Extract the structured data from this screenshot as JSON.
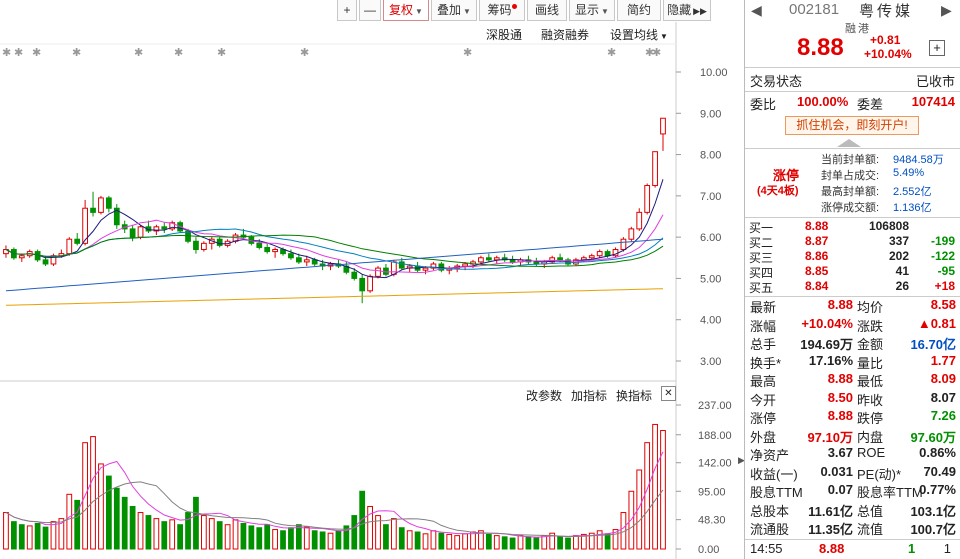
{
  "toolbar": {
    "plus": "+",
    "minus": "—",
    "restore": "复权",
    "overlay": "叠加",
    "chips": "筹码",
    "line_draw": "画线",
    "display": "显示",
    "simple": "简约",
    "hide": "隐藏"
  },
  "chart_links": {
    "shenzhen_connect": "深股通",
    "margin": "融资融券",
    "set_ma": "设置均线"
  },
  "indicator_links": {
    "change_params": "改参数",
    "add_indicator": "加指标",
    "swap_indicator": "换指标",
    "close": "✕"
  },
  "price_axis": [
    "10.00",
    "9.00",
    "8.00",
    "7.00",
    "6.00",
    "5.00",
    "4.00",
    "3.00"
  ],
  "volume_axis": [
    "237.00",
    "188.00",
    "142.00",
    "95.00",
    "48.30",
    "0.00"
  ],
  "colors": {
    "up": "#e00000",
    "down": "#009000",
    "ma5": "#1a1a80",
    "ma10": "#e040e0",
    "ma20": "#0080c0",
    "ma30": "#008000",
    "ma60": "#e8a000",
    "vma5": "#e040e0",
    "vma10": "#808080"
  },
  "chart_data": {
    "type": "candlestick",
    "ylim": [
      3.0,
      10.0
    ],
    "volume_ylim": [
      0,
      237
    ],
    "candles": [
      [
        5.6,
        5.8,
        5.5,
        5.7
      ],
      [
        5.7,
        5.75,
        5.45,
        5.5
      ],
      [
        5.5,
        5.6,
        5.4,
        5.55
      ],
      [
        5.55,
        5.7,
        5.5,
        5.65
      ],
      [
        5.65,
        5.7,
        5.4,
        5.45
      ],
      [
        5.45,
        5.55,
        5.3,
        5.35
      ],
      [
        5.35,
        5.6,
        5.3,
        5.55
      ],
      [
        5.55,
        5.7,
        5.5,
        5.6
      ],
      [
        5.6,
        6.0,
        5.55,
        5.95
      ],
      [
        5.95,
        6.1,
        5.8,
        5.85
      ],
      [
        5.85,
        6.9,
        5.8,
        6.7
      ],
      [
        6.7,
        7.1,
        6.5,
        6.6
      ],
      [
        6.6,
        7.0,
        6.55,
        6.95
      ],
      [
        6.95,
        7.0,
        6.6,
        6.7
      ],
      [
        6.7,
        6.8,
        6.2,
        6.3
      ],
      [
        6.3,
        6.4,
        6.1,
        6.2
      ],
      [
        6.2,
        6.3,
        5.9,
        6.0
      ],
      [
        6.0,
        6.3,
        5.95,
        6.25
      ],
      [
        6.25,
        6.4,
        6.1,
        6.15
      ],
      [
        6.15,
        6.3,
        6.05,
        6.25
      ],
      [
        6.25,
        6.35,
        6.1,
        6.2
      ],
      [
        6.2,
        6.4,
        6.15,
        6.35
      ],
      [
        6.35,
        6.4,
        6.1,
        6.15
      ],
      [
        6.15,
        6.2,
        5.85,
        5.9
      ],
      [
        5.9,
        6.0,
        5.6,
        5.7
      ],
      [
        5.7,
        5.9,
        5.65,
        5.85
      ],
      [
        5.85,
        6.0,
        5.7,
        5.95
      ],
      [
        5.95,
        6.0,
        5.75,
        5.8
      ],
      [
        5.8,
        5.95,
        5.75,
        5.9
      ],
      [
        5.9,
        6.1,
        5.85,
        6.05
      ],
      [
        6.05,
        6.2,
        5.95,
        6.0
      ],
      [
        6.0,
        6.05,
        5.8,
        5.85
      ],
      [
        5.85,
        5.95,
        5.7,
        5.75
      ],
      [
        5.75,
        5.85,
        5.6,
        5.65
      ],
      [
        5.65,
        5.75,
        5.5,
        5.7
      ],
      [
        5.7,
        5.75,
        5.55,
        5.6
      ],
      [
        5.6,
        5.7,
        5.45,
        5.5
      ],
      [
        5.5,
        5.6,
        5.35,
        5.4
      ],
      [
        5.4,
        5.55,
        5.3,
        5.45
      ],
      [
        5.45,
        5.5,
        5.3,
        5.35
      ],
      [
        5.35,
        5.45,
        5.2,
        5.3
      ],
      [
        5.3,
        5.4,
        5.2,
        5.35
      ],
      [
        5.35,
        5.45,
        5.25,
        5.3
      ],
      [
        5.3,
        5.4,
        5.1,
        5.15
      ],
      [
        5.15,
        5.25,
        4.95,
        5.0
      ],
      [
        5.0,
        5.1,
        4.4,
        4.7
      ],
      [
        4.7,
        5.1,
        4.65,
        5.05
      ],
      [
        5.05,
        5.3,
        5.0,
        5.25
      ],
      [
        5.25,
        5.35,
        5.05,
        5.1
      ],
      [
        5.1,
        5.45,
        5.05,
        5.4
      ],
      [
        5.4,
        5.5,
        5.2,
        5.25
      ],
      [
        5.25,
        5.35,
        5.15,
        5.3
      ],
      [
        5.3,
        5.4,
        5.15,
        5.2
      ],
      [
        5.2,
        5.3,
        5.1,
        5.25
      ],
      [
        5.25,
        5.4,
        5.2,
        5.35
      ],
      [
        5.35,
        5.4,
        5.15,
        5.2
      ],
      [
        5.2,
        5.3,
        5.1,
        5.25
      ],
      [
        5.25,
        5.35,
        5.15,
        5.3
      ],
      [
        5.3,
        5.4,
        5.2,
        5.35
      ],
      [
        5.35,
        5.45,
        5.25,
        5.4
      ],
      [
        5.4,
        5.55,
        5.35,
        5.5
      ],
      [
        5.5,
        5.6,
        5.4,
        5.45
      ],
      [
        5.45,
        5.55,
        5.35,
        5.5
      ],
      [
        5.5,
        5.6,
        5.4,
        5.45
      ],
      [
        5.45,
        5.55,
        5.35,
        5.4
      ],
      [
        5.4,
        5.5,
        5.3,
        5.45
      ],
      [
        5.45,
        5.55,
        5.35,
        5.4
      ],
      [
        5.4,
        5.5,
        5.3,
        5.35
      ],
      [
        5.35,
        5.45,
        5.25,
        5.4
      ],
      [
        5.4,
        5.55,
        5.35,
        5.5
      ],
      [
        5.5,
        5.6,
        5.4,
        5.45
      ],
      [
        5.45,
        5.5,
        5.3,
        5.35
      ],
      [
        5.35,
        5.5,
        5.3,
        5.45
      ],
      [
        5.45,
        5.55,
        5.4,
        5.5
      ],
      [
        5.5,
        5.6,
        5.45,
        5.55
      ],
      [
        5.55,
        5.7,
        5.5,
        5.65
      ],
      [
        5.65,
        5.7,
        5.5,
        5.55
      ],
      [
        5.55,
        5.75,
        5.5,
        5.7
      ],
      [
        5.7,
        6.0,
        5.65,
        5.95
      ],
      [
        5.95,
        6.25,
        5.9,
        6.2
      ],
      [
        6.2,
        6.7,
        6.15,
        6.6
      ],
      [
        6.6,
        7.3,
        6.55,
        7.25
      ],
      [
        7.25,
        8.07,
        7.2,
        8.07
      ],
      [
        8.5,
        8.88,
        8.09,
        8.88
      ]
    ],
    "volumes": [
      [
        60,
        1
      ],
      [
        45,
        0
      ],
      [
        40,
        0
      ],
      [
        38,
        1
      ],
      [
        42,
        0
      ],
      [
        36,
        0
      ],
      [
        45,
        1
      ],
      [
        50,
        1
      ],
      [
        90,
        1
      ],
      [
        80,
        0
      ],
      [
        175,
        1
      ],
      [
        185,
        1
      ],
      [
        140,
        1
      ],
      [
        120,
        0
      ],
      [
        100,
        0
      ],
      [
        85,
        0
      ],
      [
        70,
        0
      ],
      [
        60,
        1
      ],
      [
        55,
        0
      ],
      [
        50,
        1
      ],
      [
        45,
        0
      ],
      [
        48,
        1
      ],
      [
        40,
        0
      ],
      [
        60,
        0
      ],
      [
        85,
        0
      ],
      [
        55,
        1
      ],
      [
        50,
        1
      ],
      [
        45,
        0
      ],
      [
        40,
        1
      ],
      [
        48,
        1
      ],
      [
        42,
        0
      ],
      [
        38,
        0
      ],
      [
        35,
        0
      ],
      [
        40,
        0
      ],
      [
        32,
        1
      ],
      [
        30,
        0
      ],
      [
        35,
        0
      ],
      [
        40,
        0
      ],
      [
        36,
        1
      ],
      [
        30,
        0
      ],
      [
        28,
        0
      ],
      [
        26,
        1
      ],
      [
        30,
        0
      ],
      [
        38,
        0
      ],
      [
        55,
        0
      ],
      [
        95,
        0
      ],
      [
        70,
        1
      ],
      [
        55,
        1
      ],
      [
        40,
        0
      ],
      [
        50,
        1
      ],
      [
        35,
        0
      ],
      [
        30,
        1
      ],
      [
        28,
        0
      ],
      [
        25,
        1
      ],
      [
        30,
        1
      ],
      [
        26,
        0
      ],
      [
        24,
        1
      ],
      [
        22,
        1
      ],
      [
        25,
        1
      ],
      [
        28,
        1
      ],
      [
        30,
        1
      ],
      [
        24,
        0
      ],
      [
        22,
        1
      ],
      [
        20,
        0
      ],
      [
        18,
        0
      ],
      [
        22,
        1
      ],
      [
        20,
        0
      ],
      [
        18,
        0
      ],
      [
        22,
        1
      ],
      [
        26,
        1
      ],
      [
        20,
        0
      ],
      [
        18,
        0
      ],
      [
        22,
        1
      ],
      [
        24,
        1
      ],
      [
        26,
        1
      ],
      [
        30,
        1
      ],
      [
        25,
        0
      ],
      [
        32,
        1
      ],
      [
        60,
        1
      ],
      [
        95,
        1
      ],
      [
        130,
        1
      ],
      [
        175,
        1
      ],
      [
        205,
        1
      ],
      [
        195,
        1
      ]
    ]
  },
  "quote": {
    "code": "002181",
    "name": "粤传媒",
    "tag_margin": "融",
    "tag_hk": "港",
    "price": "8.88",
    "change": "+0.81",
    "change_pct": "+10.04%",
    "add": "+",
    "prev_arrow": "◀",
    "next_arrow": "▶"
  },
  "status": {
    "label": "交易状态",
    "value": "已收市"
  },
  "order_ratio": {
    "label1": "委比",
    "value1": "100.00%",
    "label2": "委差",
    "value2": "107414"
  },
  "promo": "抓住机会，即刻开户!",
  "limit_up": {
    "title": "涨停",
    "subtitle": "(4天4板)",
    "rows": [
      {
        "label": "当前封单额:",
        "value": "9484.58万"
      },
      {
        "label": "封单占成交:",
        "value": "5.49%"
      },
      {
        "label": "最高封单额:",
        "value": "2.552亿"
      },
      {
        "label": "涨停成交额:",
        "value": "1.136亿"
      }
    ]
  },
  "order_book": [
    {
      "label": "买一",
      "price": "8.88",
      "volume": "106808",
      "change": ""
    },
    {
      "label": "买二",
      "price": "8.87",
      "volume": "337",
      "change": "-199"
    },
    {
      "label": "买三",
      "price": "8.86",
      "volume": "202",
      "change": "-122"
    },
    {
      "label": "买四",
      "price": "8.85",
      "volume": "41",
      "change": "-95"
    },
    {
      "label": "买五",
      "price": "8.84",
      "volume": "26",
      "change": "+18"
    }
  ],
  "stats": [
    {
      "l1": "最新",
      "v1": "8.88",
      "c1": "red",
      "l2": "均价",
      "v2": "8.58",
      "c2": "red"
    },
    {
      "l1": "涨幅",
      "v1": "+10.04%",
      "c1": "red",
      "l2": "涨跌",
      "v2": "▲0.81",
      "c2": "red"
    },
    {
      "l1": "总手",
      "v1": "194.69万",
      "c1": "dark",
      "l2": "金额",
      "v2": "16.70亿",
      "c2": "blue"
    },
    {
      "l1": "换手*",
      "v1": "17.16%",
      "c1": "dark",
      "l2": "量比",
      "v2": "1.77",
      "c2": "red"
    },
    {
      "l1": "最高",
      "v1": "8.88",
      "c1": "red",
      "l2": "最低",
      "v2": "8.09",
      "c2": "red"
    },
    {
      "l1": "今开",
      "v1": "8.50",
      "c1": "red",
      "l2": "昨收",
      "v2": "8.07",
      "c2": "dark"
    },
    {
      "l1": "涨停",
      "v1": "8.88",
      "c1": "red",
      "l2": "跌停",
      "v2": "7.26",
      "c2": "green"
    },
    {
      "l1": "外盘",
      "v1": "97.10万",
      "c1": "red",
      "l2": "内盘",
      "v2": "97.60万",
      "c2": "green"
    },
    {
      "l1": "净资产",
      "v1": "3.67",
      "c1": "dark",
      "l2": "ROE",
      "v2": "0.86%",
      "c2": "dark"
    },
    {
      "l1": "收益(一)",
      "v1": "0.031",
      "c1": "dark",
      "l2": "PE(动)*",
      "v2": "70.49",
      "c2": "dark"
    },
    {
      "l1": "股息TTM",
      "v1": "0.07",
      "c1": "dark",
      "l2": "股息率TTM",
      "v2": "0.77%",
      "c2": "dark"
    },
    {
      "l1": "总股本",
      "v1": "11.61亿",
      "c1": "dark",
      "l2": "总值",
      "v2": "103.1亿",
      "c2": "dark"
    },
    {
      "l1": "流通股",
      "v1": "11.35亿",
      "c1": "dark",
      "l2": "流值",
      "v2": "100.7亿",
      "c2": "dark"
    }
  ],
  "tick": {
    "time": "14:55",
    "price": "8.88",
    "volume": "1",
    "count": "1"
  }
}
